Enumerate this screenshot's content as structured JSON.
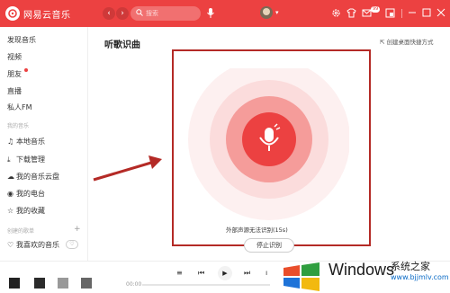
{
  "header": {
    "app_name": "网易云音乐",
    "search_placeholder": "搜索",
    "message_badge": "99",
    "accent_color": "#ec4141"
  },
  "sidebar": {
    "items": [
      {
        "label": "发现音乐"
      },
      {
        "label": "视频"
      },
      {
        "label": "朋友"
      },
      {
        "label": "直播"
      },
      {
        "label": "私人FM"
      }
    ],
    "my_music_title": "我的音乐",
    "my_music": [
      {
        "label": "本地音乐",
        "icon": "note-icon"
      },
      {
        "label": "下载管理",
        "icon": "download-icon"
      },
      {
        "label": "我的音乐云盘",
        "icon": "cloud-icon"
      },
      {
        "label": "我的电台",
        "icon": "radio-icon"
      },
      {
        "label": "我的收藏",
        "icon": "star-icon"
      }
    ],
    "created_title": "创建的歌单",
    "created": [
      {
        "label": "我喜欢的音乐",
        "icon": "heart-icon"
      }
    ]
  },
  "main": {
    "title": "听歌识曲",
    "shortcut_label": "创建桌面快捷方式",
    "status": "外部声源无法识别(15s)",
    "stop_button": "停止识别"
  },
  "player": {
    "time": "00:00"
  },
  "watermark": {
    "brand": "Windows",
    "cn": "系统之家",
    "url": "www.bjjmlv.com"
  }
}
